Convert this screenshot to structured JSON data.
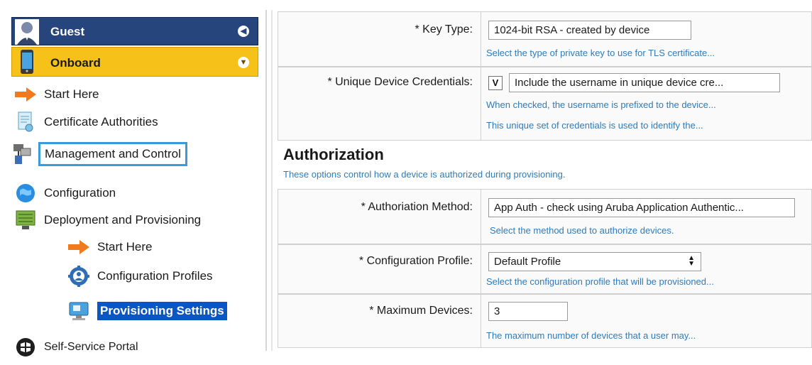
{
  "sidebar": {
    "guest_label": "Guest",
    "onboard_label": "Onboard",
    "items": [
      {
        "label": "Start Here",
        "icon": "arrow-right-icon"
      },
      {
        "label": "Certificate Authorities",
        "icon": "certificate-icon"
      },
      {
        "label": "Management and Control",
        "icon": "management-icon"
      },
      {
        "label": "Configuration",
        "icon": "globe-icon"
      },
      {
        "label": "Deployment and Provisioning",
        "icon": "server-icon"
      },
      {
        "label": "Start Here",
        "icon": "arrow-right-icon"
      },
      {
        "label": "Configuration Profiles",
        "icon": "gear-profile-icon"
      },
      {
        "label": "Provisioning Settings",
        "icon": "monitor-icon"
      },
      {
        "label": "Self-Service Portal",
        "icon": "portal-icon"
      }
    ]
  },
  "form": {
    "key_type": {
      "label": "* Key Type:",
      "value": "1024-bit RSA - created by device",
      "hint": "Select the type of private key to use for TLS certificate..."
    },
    "unique_credentials": {
      "label": "* Unique Device Credentials:",
      "checked_mark": "V",
      "value": "Include the username in unique device cre...",
      "hint1": "When checked, the username is prefixed to the device...",
      "hint2": "This unique set of credentials is used to identify the..."
    },
    "authorization": {
      "title": "Authorization",
      "description": "These options control how a device is authorized during provisioning."
    },
    "auth_method": {
      "label": "* Authoriation Method:",
      "value": "App Auth - check using Aruba Application Authentic...",
      "hint": "Select the method used to authorize devices."
    },
    "config_profile": {
      "label": "* Configuration Profile:",
      "value": "Default Profile",
      "hint": "Select the configuration profile that will be provisioned..."
    },
    "max_devices": {
      "label": "* Maximum Devices:",
      "value": "3",
      "hint": "The maximum number of devices that a user may..."
    }
  },
  "colors": {
    "guest_bar": "#26457d",
    "onboard_bar": "#f6c21a",
    "selected_item": "#0a56c4",
    "hint_text": "#2e7bbb",
    "focus_outline": "#3b9ad9"
  }
}
